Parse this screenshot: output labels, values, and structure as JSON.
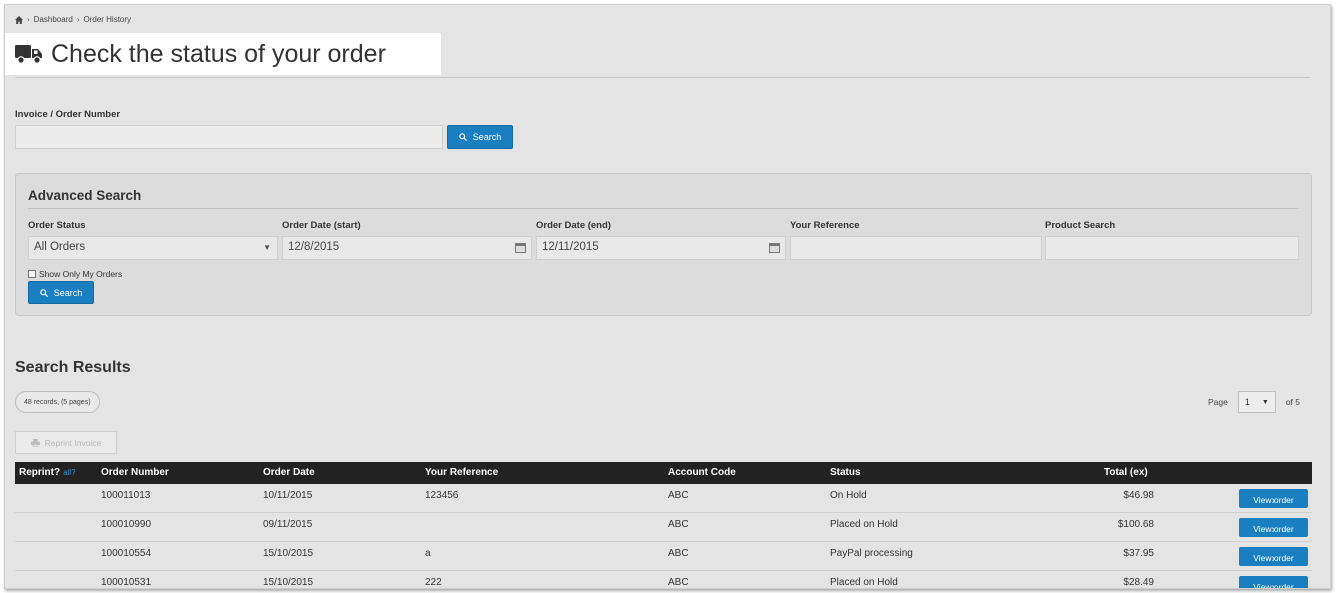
{
  "breadcrumb": {
    "items": [
      "Dashboard",
      "Order History"
    ]
  },
  "page": {
    "title": "Check the status of your order"
  },
  "quick_search": {
    "label": "Invoice / Order Number",
    "value": "",
    "button_label": "Search"
  },
  "advanced": {
    "title": "Advanced Search",
    "order_status": {
      "label": "Order Status",
      "value": "All Orders"
    },
    "date_start": {
      "label": "Order Date (start)",
      "value": "12/8/2015"
    },
    "date_end": {
      "label": "Order Date (end)",
      "value": "12/11/2015"
    },
    "your_reference": {
      "label": "Your Reference",
      "value": ""
    },
    "product_search": {
      "label": "Product Search",
      "value": ""
    },
    "only_mine_label": "Show Only My Orders",
    "button_label": "Search"
  },
  "results": {
    "title": "Search Results",
    "records_label": "48 records, (5 pages)",
    "page_label": "Page",
    "page_value": "1",
    "of_label": "of 5",
    "reprint_label": "Reprint Invoice",
    "columns": {
      "reprint": "Reprint?",
      "reprint_hint": "all?",
      "order_number": "Order Number",
      "order_date": "Order Date",
      "your_reference": "Your Reference",
      "account_code": "Account Code",
      "status": "Status",
      "total": "Total (ex)"
    },
    "view_label": "View order",
    "rows": [
      {
        "order_number": "100011013",
        "order_date": "10/11/2015",
        "your_reference": "123456",
        "account_code": "ABC",
        "status": "On Hold",
        "total": "$46.98"
      },
      {
        "order_number": "100010990",
        "order_date": "09/11/2015",
        "your_reference": "",
        "account_code": "ABC",
        "status": "Placed on Hold",
        "total": "$100.68"
      },
      {
        "order_number": "100010554",
        "order_date": "15/10/2015",
        "your_reference": "a",
        "account_code": "ABC",
        "status": "PayPal processing",
        "total": "$37.95"
      },
      {
        "order_number": "100010531",
        "order_date": "15/10/2015",
        "your_reference": "222",
        "account_code": "ABC",
        "status": "Placed on Hold",
        "total": "$28.49"
      }
    ]
  },
  "icons": {
    "home": "home-icon",
    "truck": "truck-icon",
    "search": "search-icon",
    "calendar": "calendar-icon",
    "chevron": "chevron-right-icon",
    "print": "print-icon"
  },
  "colors": {
    "accent": "#1a7fc1",
    "header_bg": "#222222",
    "background": "#e4e4e4"
  }
}
